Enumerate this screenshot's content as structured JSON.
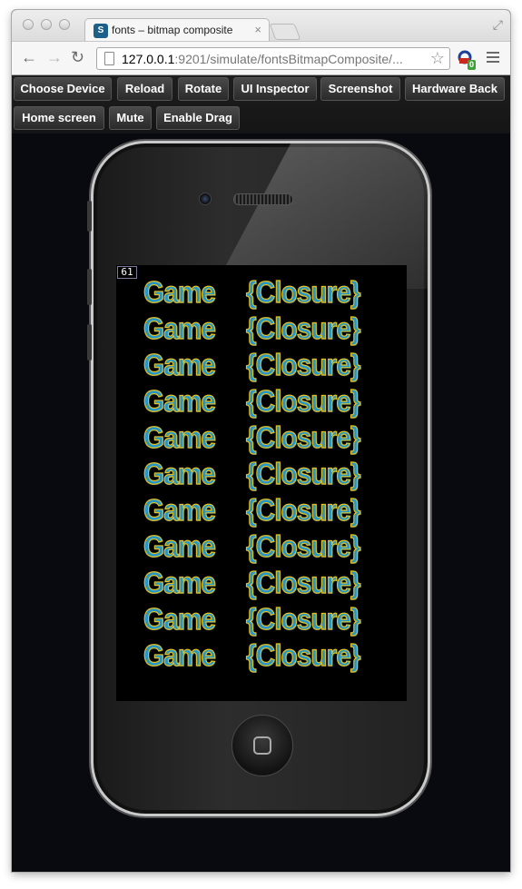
{
  "tab": {
    "favicon": "S",
    "title": "fonts – bitmap composite",
    "close": "×"
  },
  "nav": {
    "back": "←",
    "forward": "→",
    "reload": "↻"
  },
  "address": {
    "host": "127.0.0.1",
    "rest": ":9201/simulate/fontsBitmapComposite/...",
    "star": "☆"
  },
  "extension": {
    "badge": "0"
  },
  "fullscreen_glyph": "⤢",
  "controls": {
    "row1": [
      "Choose Device",
      "Reload",
      "Rotate",
      "UI Inspector",
      "Screenshot",
      "Hardware Back"
    ],
    "row2": [
      "Home screen",
      "Mute",
      "Enable Drag"
    ]
  },
  "screen": {
    "fps": "61",
    "rows": [
      {
        "left": "Game",
        "right": "{Closure}"
      },
      {
        "left": "Game",
        "right": "{Closure}"
      },
      {
        "left": "Game",
        "right": "{Closure}"
      },
      {
        "left": "Game",
        "right": "{Closure}"
      },
      {
        "left": "Game",
        "right": "{Closure}"
      },
      {
        "left": "Game",
        "right": "{Closure}"
      },
      {
        "left": "Game",
        "right": "{Closure}"
      },
      {
        "left": "Game",
        "right": "{Closure}"
      },
      {
        "left": "Game",
        "right": "{Closure}"
      },
      {
        "left": "Game",
        "right": "{Closure}"
      },
      {
        "left": "Game",
        "right": "{Closure}"
      }
    ]
  },
  "colors": {
    "app_background": "#090a0f",
    "text_fill": "#2596c8",
    "text_outline": "#e7c21f"
  }
}
